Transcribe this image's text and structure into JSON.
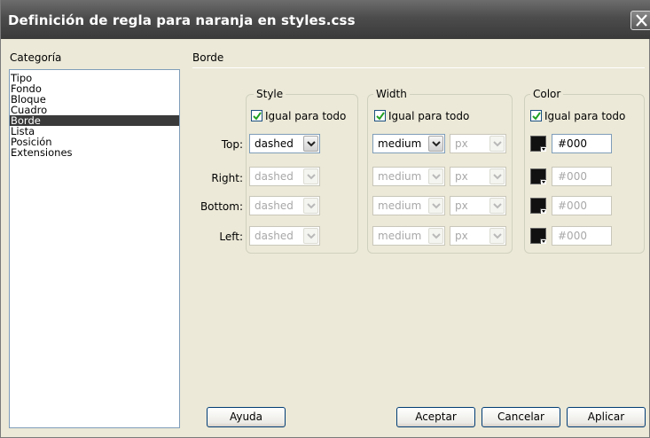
{
  "window": {
    "title": "Definición de regla para naranja en styles.css"
  },
  "categories": {
    "label": "Categoría",
    "items": [
      "Tipo",
      "Fondo",
      "Bloque",
      "Cuadro",
      "Borde",
      "Lista",
      "Posición",
      "Extensiones"
    ],
    "selected": "Borde"
  },
  "section": {
    "title": "Borde"
  },
  "groups": {
    "style": {
      "legend": "Style",
      "same_all": "Igual para todo",
      "checked": true
    },
    "width": {
      "legend": "Width",
      "same_all": "Igual para todo",
      "checked": true
    },
    "color": {
      "legend": "Color",
      "same_all": "Igual para todo",
      "checked": true
    }
  },
  "rows": [
    {
      "label": "Top:",
      "style": "dashed",
      "width": "medium",
      "unit": "px",
      "color": "#000",
      "enabled": true
    },
    {
      "label": "Right:",
      "style": "dashed",
      "width": "medium",
      "unit": "px",
      "color": "#000",
      "enabled": false
    },
    {
      "label": "Bottom:",
      "style": "dashed",
      "width": "medium",
      "unit": "px",
      "color": "#000",
      "enabled": false
    },
    {
      "label": "Left:",
      "style": "dashed",
      "width": "medium",
      "unit": "px",
      "color": "#000",
      "enabled": false
    }
  ],
  "buttons": {
    "help": "Ayuda",
    "ok": "Aceptar",
    "cancel": "Cancelar",
    "apply": "Aplicar"
  },
  "icons": {
    "close": "close-icon",
    "checkbox_checked": "checkmark-icon",
    "dropdown": "chevron-down-icon",
    "color_picker": "color-swatch-icon"
  },
  "colors": {
    "swatch": "#111111",
    "selection_bg": "#3a3a3a",
    "titlebar": "#4c4c4c"
  }
}
